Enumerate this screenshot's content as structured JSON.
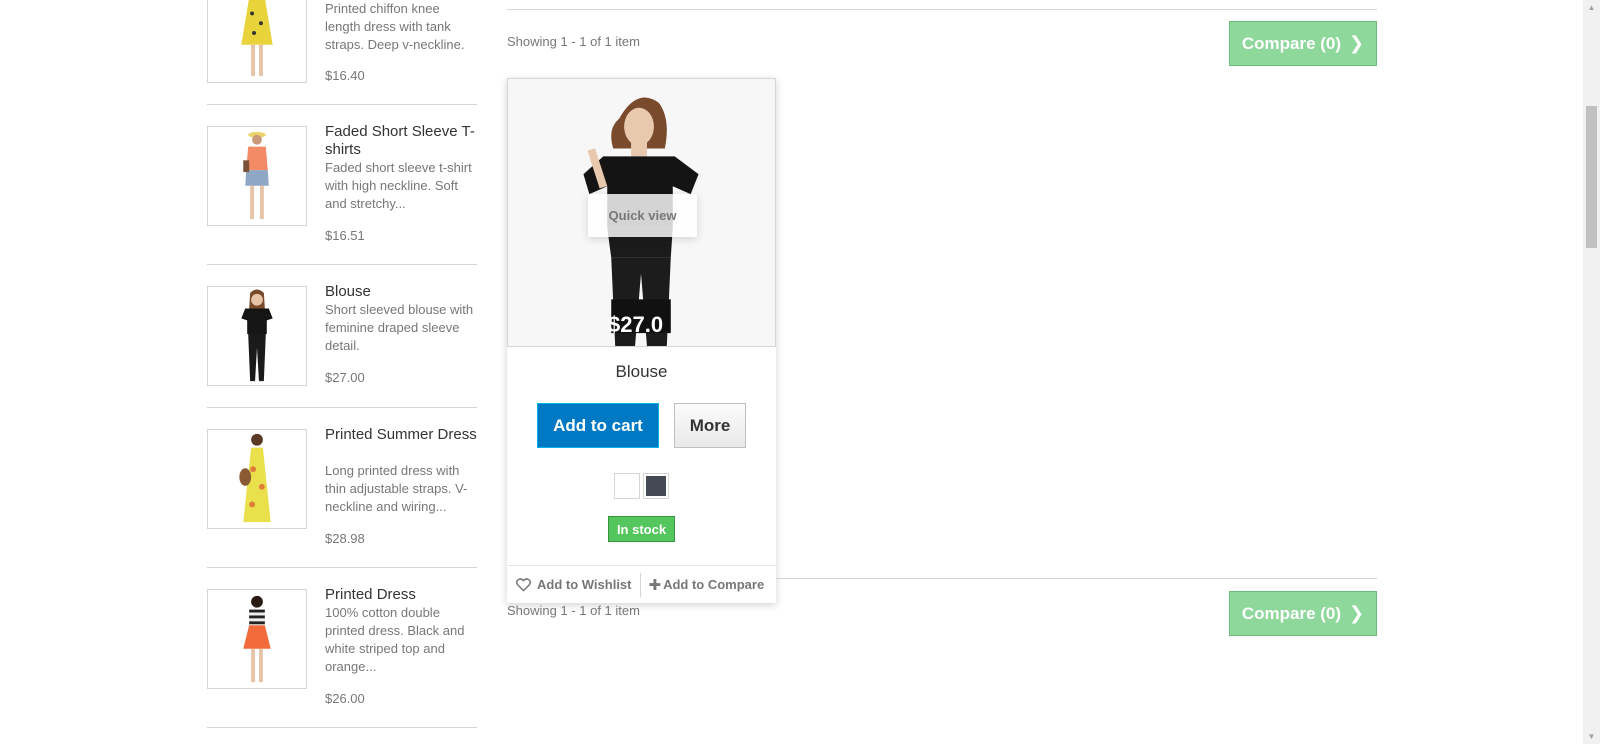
{
  "sidebar": {
    "items": [
      {
        "name": "",
        "description": "Printed chiffon knee length dress with tank straps. Deep v-neckline.",
        "price": "$16.40",
        "image": "yellow-floral-dress"
      },
      {
        "name": "Faded Short Sleeve T-shirts",
        "description": "Faded short sleeve t-shirt with high neckline. Soft and stretchy...",
        "price": "$16.51",
        "image": "orange-tshirt"
      },
      {
        "name": "Blouse",
        "description": "Short sleeved blouse with feminine draped sleeve detail.",
        "price": "$27.00",
        "image": "black-blouse"
      },
      {
        "name": "Printed Summer Dress",
        "description": "Long printed dress with thin adjustable straps. V-neckline and wiring...",
        "price": "$28.98",
        "image": "yellow-summer-dress"
      },
      {
        "name": "Printed Dress",
        "description": "100% cotton double printed dress. Black and white striped top and orange...",
        "price": "$26.00",
        "image": "striped-orange-dress"
      }
    ]
  },
  "results": {
    "showing_top": "Showing 1 - 1 of 1 item",
    "showing_bottom": "Showing 1 - 1 of 1 item",
    "compare_label": "Compare (0)"
  },
  "product": {
    "name": "Blouse",
    "image_price": "$27.0",
    "quick_view": "Quick view",
    "add_to_cart": "Add to cart",
    "more": "More",
    "swatches": [
      "#ffffff",
      "#434a54"
    ],
    "stock": "In stock",
    "wishlist": "Add to Wishlist",
    "add_compare": "Add to Compare"
  },
  "colors": {
    "cart_blue": "#0079c4",
    "compare_green": "#8fd89c",
    "stock_green": "#55c65e"
  }
}
